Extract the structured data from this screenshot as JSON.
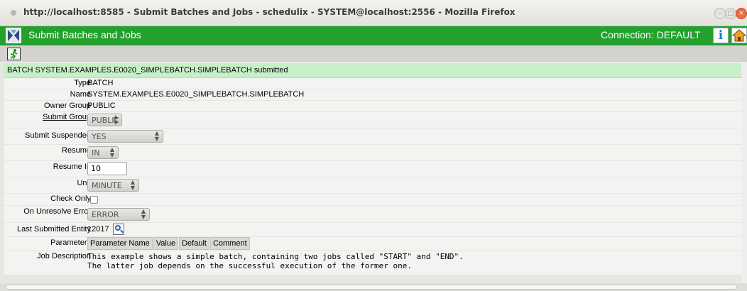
{
  "window": {
    "title": "http://localhost:8585 - Submit Batches and Jobs - schedulix - SYSTEM@localhost:2556 - Mozilla Firefox"
  },
  "header": {
    "title": "Submit Batches and Jobs",
    "connection": "Connection: DEFAULT",
    "info_glyph": "i"
  },
  "message": "BATCH SYSTEM.EXAMPLES.E0020_SIMPLEBATCH.SIMPLEBATCH submitted",
  "form": {
    "type": {
      "label": "Type",
      "value": "BATCH"
    },
    "name": {
      "label": "Name",
      "value": "SYSTEM.EXAMPLES.E0020_SIMPLEBATCH.SIMPLEBATCH"
    },
    "owner_group": {
      "label": "Owner Group",
      "value": "PUBLIC"
    },
    "submit_group": {
      "label": "Submit Group",
      "value": "PUBLIC"
    },
    "submit_suspended": {
      "label": "Submit Suspended",
      "value": "YES"
    },
    "resume": {
      "label": "Resume",
      "value": "IN"
    },
    "resume_in": {
      "label": "Resume In",
      "value": "10"
    },
    "unit": {
      "label": "Unit",
      "value": "MINUTE"
    },
    "check_only": {
      "label": "Check Only",
      "checked": false
    },
    "on_unresolve_error": {
      "label": "On Unresolve Error",
      "value": "ERROR"
    },
    "last_submitted_entity": {
      "label": "Last Submitted Entity",
      "value": "12017"
    },
    "parameters": {
      "label": "Parameters",
      "columns": [
        "Parameter Name",
        "Value",
        "Default",
        "Comment"
      ]
    },
    "job_description": {
      "label": "Job Description",
      "lines": [
        "This example shows a simple batch, containing two jobs called \"START\" and \"END\".",
        "The latter job depends on the successful execution of the former one."
      ]
    }
  },
  "icons": {
    "window_dot": "circle-icon",
    "logo": "schedulix-logo-icon",
    "info": "info-icon",
    "home": "home-icon",
    "submit": "running-man-icon",
    "lookup": "magnifier-icon"
  },
  "colors": {
    "header_green": "#24a02d",
    "message_bg": "#c8f0c8",
    "form_bg": "#e7e6e3"
  }
}
